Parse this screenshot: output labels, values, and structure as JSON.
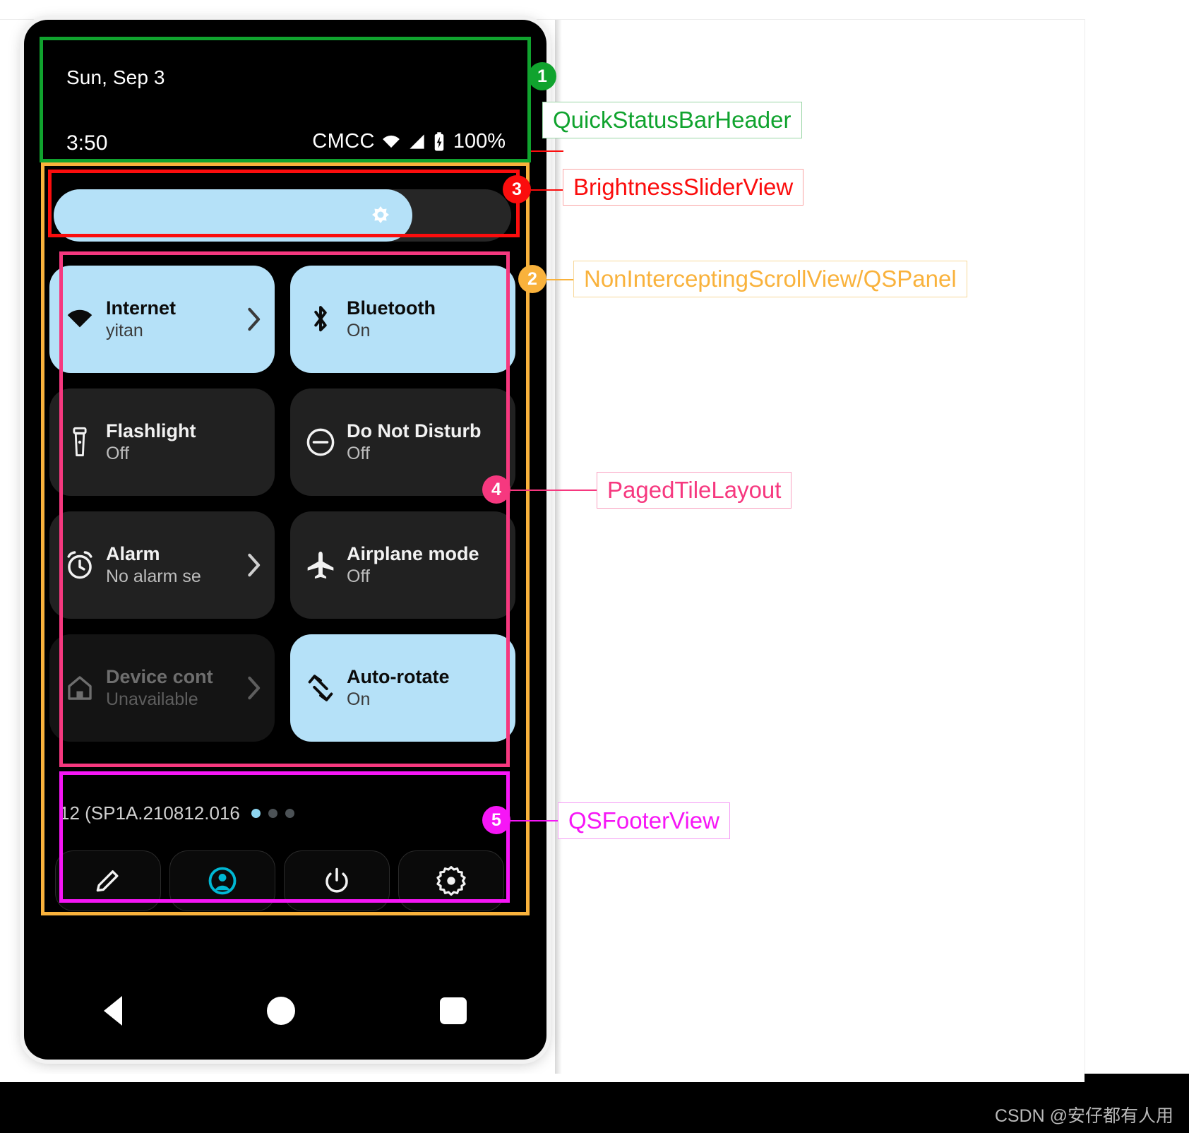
{
  "statusbar": {
    "date": "Sun, Sep 3",
    "clock": "3:50",
    "carrier": "CMCC",
    "battery_percent": "100%",
    "icons": [
      "wifi-icon",
      "signal-icon",
      "battery-charging-icon"
    ]
  },
  "brightness": {
    "label": "brightness-slider",
    "value_percent": 77,
    "fill_color": "#b5e1f8",
    "track_color": "#262626"
  },
  "tiles": [
    {
      "label": "Internet",
      "state": "yitan",
      "icon": "wifi-icon",
      "active": true,
      "disabled": false,
      "chevron": true
    },
    {
      "label": "Bluetooth",
      "state": "On",
      "icon": "bluetooth-icon",
      "active": true,
      "disabled": false,
      "chevron": false
    },
    {
      "label": "Flashlight",
      "state": "Off",
      "icon": "flashlight-icon",
      "active": false,
      "disabled": false,
      "chevron": false
    },
    {
      "label": "Do Not Disturb",
      "state": "Off",
      "icon": "do-not-disturb-icon",
      "active": false,
      "disabled": false,
      "chevron": false
    },
    {
      "label": "Alarm",
      "state": "No alarm se",
      "icon": "alarm-clock-icon",
      "active": false,
      "disabled": false,
      "chevron": true
    },
    {
      "label": "Airplane mode",
      "state": "Off",
      "icon": "airplane-icon",
      "active": false,
      "disabled": false,
      "chevron": false
    },
    {
      "label": "Device cont",
      "state": "Unavailable",
      "icon": "home-icon",
      "active": false,
      "disabled": true,
      "chevron": true
    },
    {
      "label": "Auto-rotate",
      "state": "On",
      "icon": "auto-rotate-icon",
      "active": true,
      "disabled": false,
      "chevron": false
    }
  ],
  "footer": {
    "build_text": "12 (SP1A.210812.016",
    "build_text_dim": ")",
    "page_dots": {
      "count": 3,
      "active_index": 0,
      "active_color": "#8ed6f0",
      "inactive_color": "#4c5256"
    },
    "buttons": [
      {
        "name": "edit-button",
        "icon": "pencil-icon"
      },
      {
        "name": "user-button",
        "icon": "user-avatar-icon",
        "color": "#00b8d4"
      },
      {
        "name": "power-button",
        "icon": "power-icon"
      },
      {
        "name": "settings-button",
        "icon": "gear-icon"
      }
    ]
  },
  "navbar": {
    "back": "back-triangle-icon",
    "home": "home-circle-icon",
    "recents": "recents-square-icon"
  },
  "annotations": [
    {
      "number": "1",
      "label": "QuickStatusBarHeader",
      "color": "#10a32e"
    },
    {
      "number": "2",
      "label": "NonInterceptingScrollView/QSPanel",
      "color": "#f9b23c"
    },
    {
      "number": "3",
      "label": "BrightnessSliderView",
      "color": "#fb0d0d"
    },
    {
      "number": "4",
      "label": "PagedTileLayout",
      "color": "#f6387f"
    },
    {
      "number": "5",
      "label": "QSFooterView",
      "color": "#f616f6"
    }
  ],
  "watermark": "CSDN @安仔都有人用"
}
